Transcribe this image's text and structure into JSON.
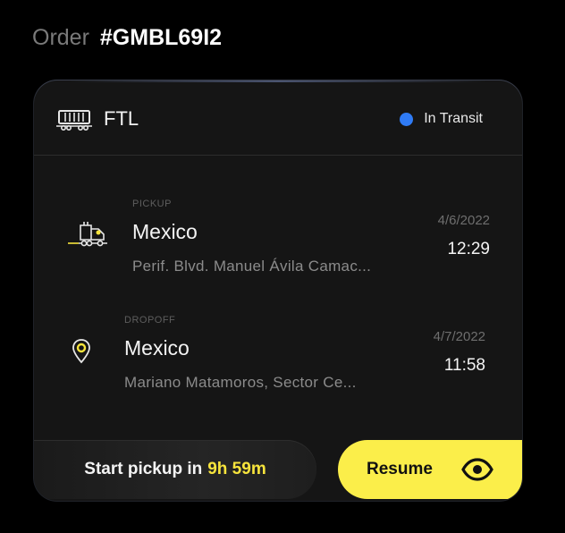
{
  "order": {
    "prefix": "Order",
    "number": "#GMBL69I2"
  },
  "shipment": {
    "load_type": "FTL",
    "load_icon": "trailer-icon",
    "status": "In Transit",
    "status_color": "#2f7bf5"
  },
  "pickup": {
    "label": "PICKUP",
    "icon": "truck-icon",
    "city": "Mexico",
    "address": "Perif. Blvd. Manuel Ávila Camac...",
    "date": "4/6/2022",
    "time": "12:29"
  },
  "dropoff": {
    "label": "DROPOFF",
    "icon": "location-pin-icon",
    "city": "Mexico",
    "address": "Mariano Matamoros, Sector Ce...",
    "date": "4/7/2022",
    "time": "11:58"
  },
  "actions": {
    "start_prefix": "Start pickup in",
    "start_countdown": "9h 59m",
    "resume_label": "Resume",
    "resume_icon": "eye-icon",
    "accent": "#fbee4a"
  }
}
